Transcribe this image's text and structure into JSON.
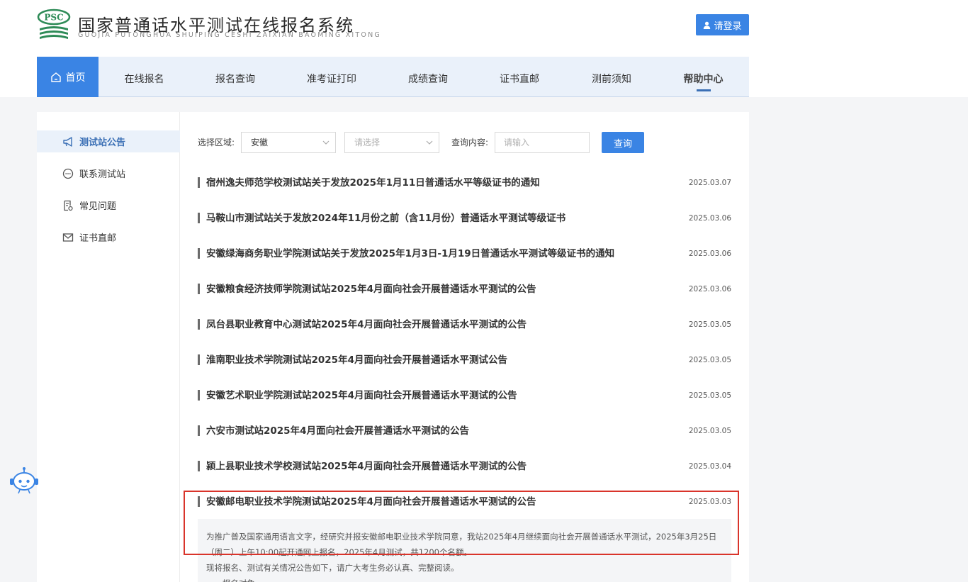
{
  "header": {
    "logo_badge_text": "PSC",
    "title": "国家普通话水平测试在线报名系统",
    "subtitle": "GUOJIA PUTONGHUA SHUIPING CESHI ZAIXIAN BAOMING XITONG",
    "login_label": "请登录"
  },
  "nav": {
    "items": [
      {
        "label": "首页",
        "active": true
      },
      {
        "label": "在线报名"
      },
      {
        "label": "报名查询"
      },
      {
        "label": "准考证打印"
      },
      {
        "label": "成绩查询"
      },
      {
        "label": "证书直邮"
      },
      {
        "label": "测前须知"
      },
      {
        "label": "帮助中心",
        "bold": true
      }
    ]
  },
  "sidebar": {
    "items": [
      {
        "label": "测试站公告",
        "icon": "megaphone-icon",
        "active": true
      },
      {
        "label": "联系测试站",
        "icon": "chat-icon"
      },
      {
        "label": "常见问题",
        "icon": "document-icon"
      },
      {
        "label": "证书直邮",
        "icon": "mail-icon"
      }
    ]
  },
  "filters": {
    "region_label": "选择区域:",
    "region_value": "安徽",
    "sub_region_placeholder": "请选择",
    "query_label": "查询内容:",
    "query_placeholder": "请输入",
    "query_button": "查询"
  },
  "news": [
    {
      "title": "宿州逸夫师范学校测试站关于发放2025年1月11日普通话水平等级证书的通知",
      "date": "2025.03.07"
    },
    {
      "title": "马鞍山市测试站关于发放2024年11月份之前（含11月份）普通话水平测试等级证书",
      "date": "2025.03.06"
    },
    {
      "title": "安徽绿海商务职业学院测试站关于发放2025年1月3日-1月19日普通话水平测试等级证书的通知",
      "date": "2025.03.06"
    },
    {
      "title": "安徽粮食经济技师学院测试站2025年4月面向社会开展普通话水平测试的公告",
      "date": "2025.03.06"
    },
    {
      "title": "凤台县职业教育中心测试站2025年4月面向社会开展普通话水平测试的公告",
      "date": "2025.03.05"
    },
    {
      "title": "淮南职业技术学院测试站2025年4月面向社会开展普通话水平测试公告",
      "date": "2025.03.05"
    },
    {
      "title": "安徽艺术职业学院测试站2025年4月面向社会开展普通话水平测试的公告",
      "date": "2025.03.05"
    },
    {
      "title": "六安市测试站2025年4月面向社会开展普通话水平测试的公告",
      "date": "2025.03.05"
    },
    {
      "title": "颍上县职业技术学校测试站2025年4月面向社会开展普通话水平测试的公告",
      "date": "2025.03.04"
    },
    {
      "title": "安徽邮电职业技术学院测试站2025年4月面向社会开展普通话水平测试的公告",
      "date": "2025.03.03"
    }
  ],
  "detail": {
    "line1": "为推广普及国家通用语言文字，经研究并报安徽邮电职业技术学院同意，我站2025年4月继续面向社会开展普通话水平测试，2025年3月25日",
    "line2": "（周二）上午10:00起开通网上报名，2025年4月测试，共1200个名额。",
    "line3": "现将报名、测试有关情况公告如下，请广大考生务必认真、完整阅读。",
    "line4": "一、报名对象"
  },
  "colors": {
    "primary": "#3a84e4",
    "nav_bg": "#eaf1fa",
    "highlight_border": "#d9342b"
  }
}
